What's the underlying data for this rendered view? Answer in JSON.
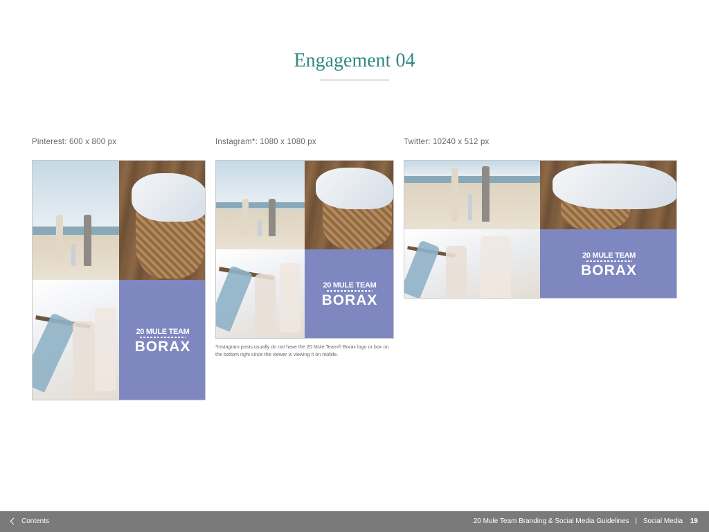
{
  "page": {
    "title": "Engagement 04"
  },
  "examples": [
    {
      "label": "Pinterest: 600 x 800 px"
    },
    {
      "label": "Instagram*: 1080 x 1080 px"
    },
    {
      "label": "Twitter: 10240 x 512 px"
    }
  ],
  "brand": {
    "line1": "20 MULE TEAM",
    "line2": "BORAX",
    "color": "#7f87c0"
  },
  "instagram_note": {
    "part1": "*Instagram posts usually ",
    "italic": "do not",
    "part2": " have the 20 Mule Team® Borax logo or box on the bottom right since the viewer is viewing it on mobile."
  },
  "footer": {
    "back_label": "Contents",
    "back_icon": "chevron-left-icon",
    "doc_title": "20 Mule Team Branding & Social Media Guidelines",
    "separator": "|",
    "section": "Social Media",
    "page_number": "19"
  },
  "colors": {
    "title": "#2f8a86",
    "footer_bg": "#7a7a7a"
  }
}
